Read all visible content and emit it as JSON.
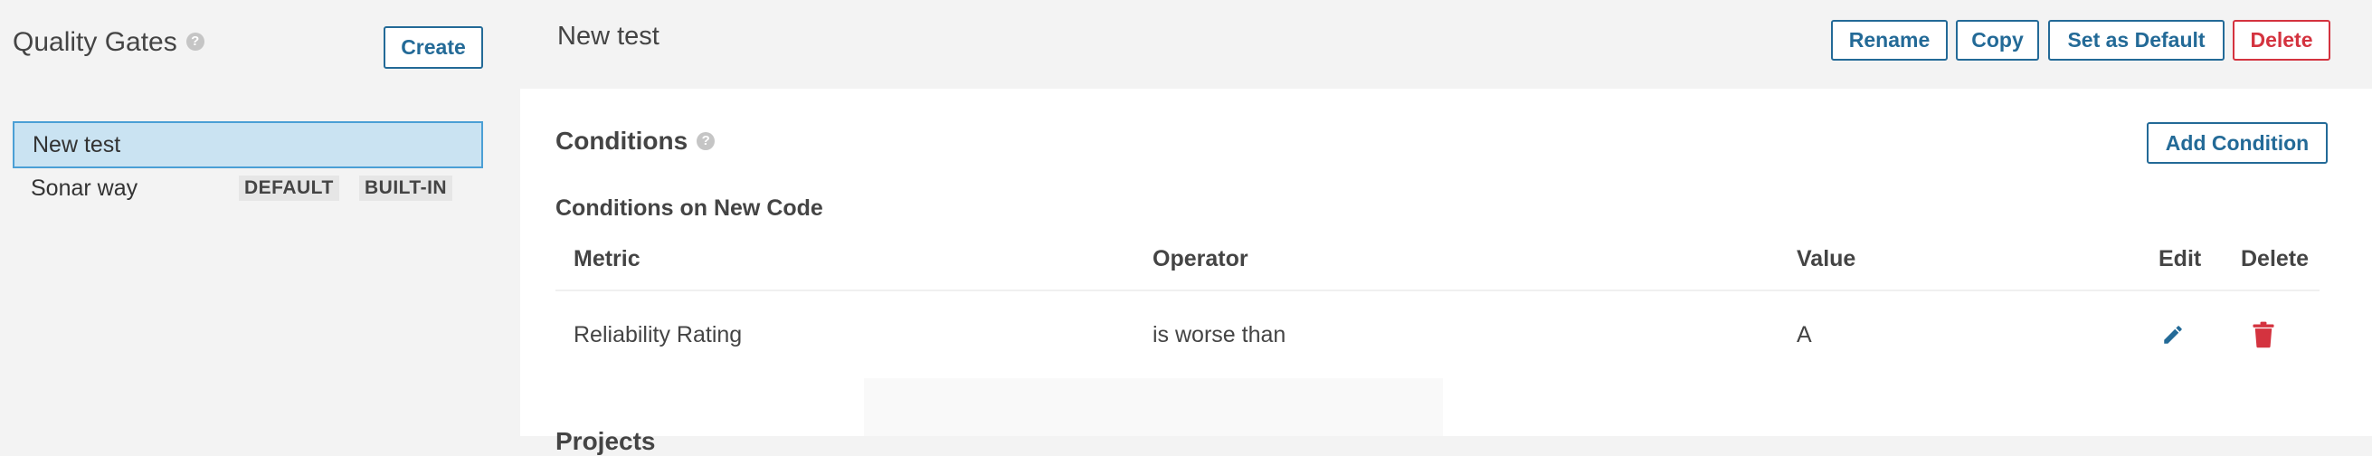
{
  "sidebar": {
    "title": "Quality Gates",
    "help_icon": "?",
    "create_label": "Create",
    "items": [
      {
        "label": "New test",
        "selected": true
      },
      {
        "label": "Sonar way",
        "badges": [
          "DEFAULT",
          "BUILT-IN"
        ]
      }
    ]
  },
  "header": {
    "title": "New test",
    "actions": {
      "rename": "Rename",
      "copy": "Copy",
      "set_default": "Set as Default",
      "delete": "Delete"
    }
  },
  "conditions": {
    "title": "Conditions",
    "help_icon": "?",
    "add_label": "Add Condition",
    "subtitle": "Conditions on New Code",
    "columns": [
      "Metric",
      "Operator",
      "Value",
      "Edit",
      "Delete"
    ],
    "rows": [
      {
        "metric": "Reliability Rating",
        "operator": "is worse than",
        "value": "A"
      }
    ],
    "next_section_partial": "Projects"
  },
  "colors": {
    "accent": "#236a97",
    "danger": "#d4333f",
    "selected_bg": "#cae3f2",
    "selected_border": "#4b9fd5"
  }
}
